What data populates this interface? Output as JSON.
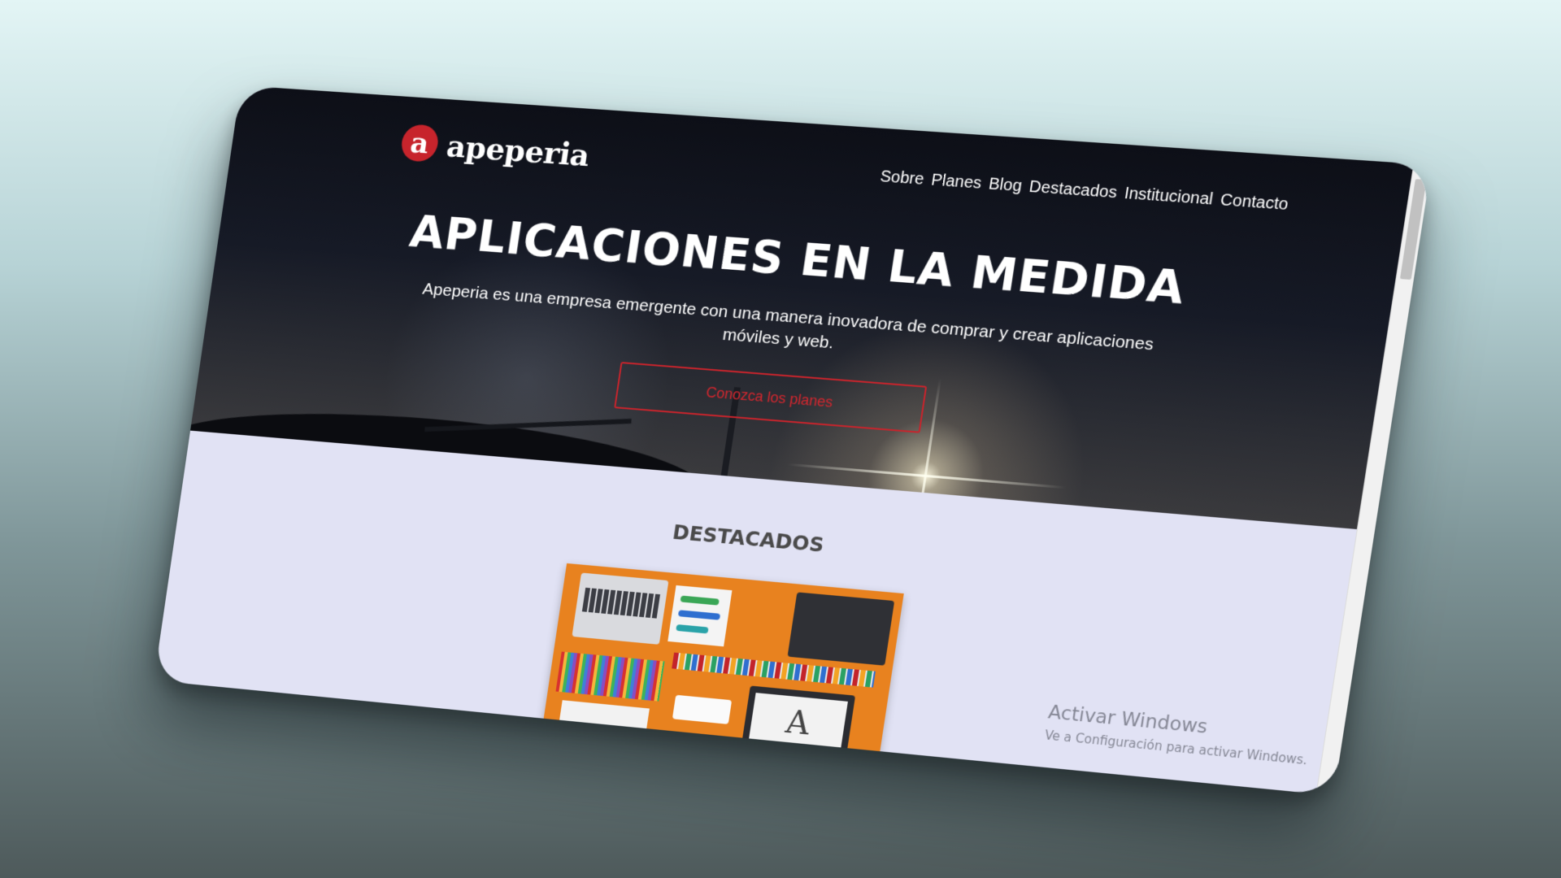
{
  "brand": {
    "logo_letter": "a",
    "name": "apeperia",
    "accent_color": "#c7242c"
  },
  "nav": {
    "links": [
      "Sobre",
      "Planes",
      "Blog",
      "Destacados",
      "Institucional",
      "Contacto"
    ]
  },
  "hero": {
    "title": "APLICACIONES EN LA MEDIDA",
    "subtitle": "Apeperia es una empresa emergente con una manera inovadora de comprar y crear aplicaciones móviles y web.",
    "cta_label": "Conozca los planes"
  },
  "featured": {
    "title": "DESTACADOS",
    "image_icon": "creative-workspace-illustration"
  },
  "windows_watermark": {
    "title": "Activar Windows",
    "subtitle": "Ve a Configuración para activar Windows."
  }
}
